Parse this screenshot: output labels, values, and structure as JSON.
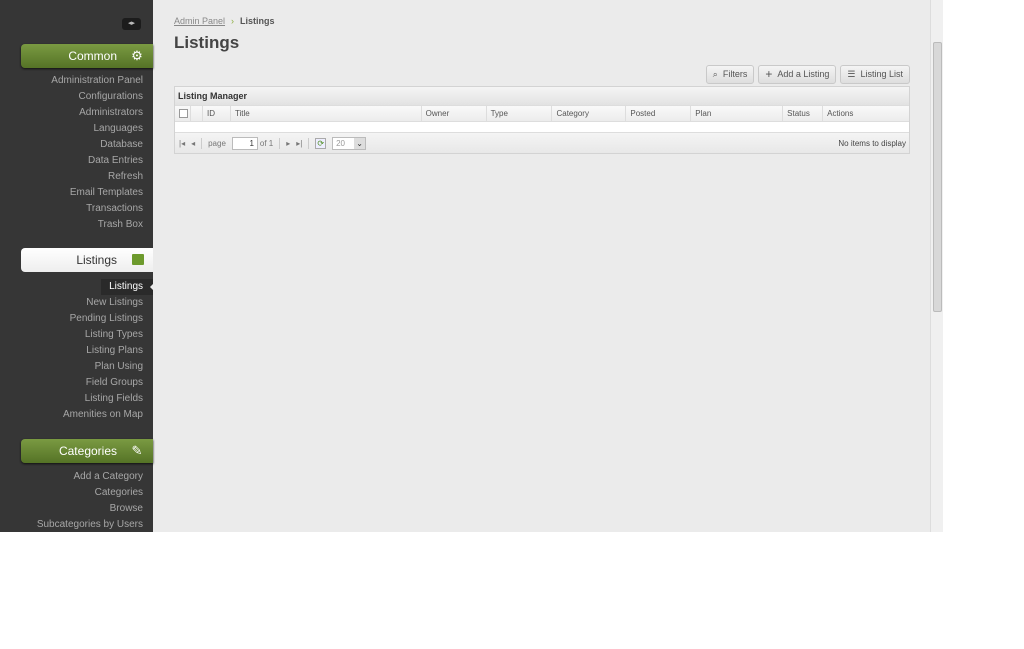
{
  "sidebar": {
    "toggle_icon": "collapse-arrows",
    "sections": [
      {
        "label": "Common",
        "icon": "gear-icon",
        "items": [
          "Administration Panel",
          "Configurations",
          "Administrators",
          "Languages",
          "Database",
          "Data Entries",
          "Refresh",
          "Email Templates",
          "Transactions",
          "Trash Box"
        ]
      },
      {
        "label": "Listings",
        "icon": "listings-icon",
        "items": [
          "Listings",
          "New Listings",
          "Pending Listings",
          "Listing Types",
          "Listing Plans",
          "Plan Using",
          "Field Groups",
          "Listing Fields",
          "Amenities on Map"
        ]
      },
      {
        "label": "Categories",
        "icon": "eraser-icon",
        "items": [
          "Add a Category",
          "Categories",
          "Browse",
          "Subcategories by Users"
        ]
      }
    ]
  },
  "breadcrumb": {
    "root": "Admin Panel",
    "current": "Listings"
  },
  "page_title": "Listings",
  "toolbar": {
    "filters": "Filters",
    "add": "Add a Listing",
    "list": "Listing List"
  },
  "grid": {
    "title": "Listing Manager",
    "columns": [
      "",
      "",
      "ID",
      "Title",
      "Owner",
      "Type",
      "Category",
      "Posted",
      "Plan",
      "Status",
      "Actions"
    ],
    "pager": {
      "page_label": "page",
      "page": "1",
      "of": "of 1",
      "per_page": "20",
      "status": "No items to display"
    }
  },
  "colors": {
    "accent": "#6a8a34",
    "sidebar": "#363636"
  }
}
